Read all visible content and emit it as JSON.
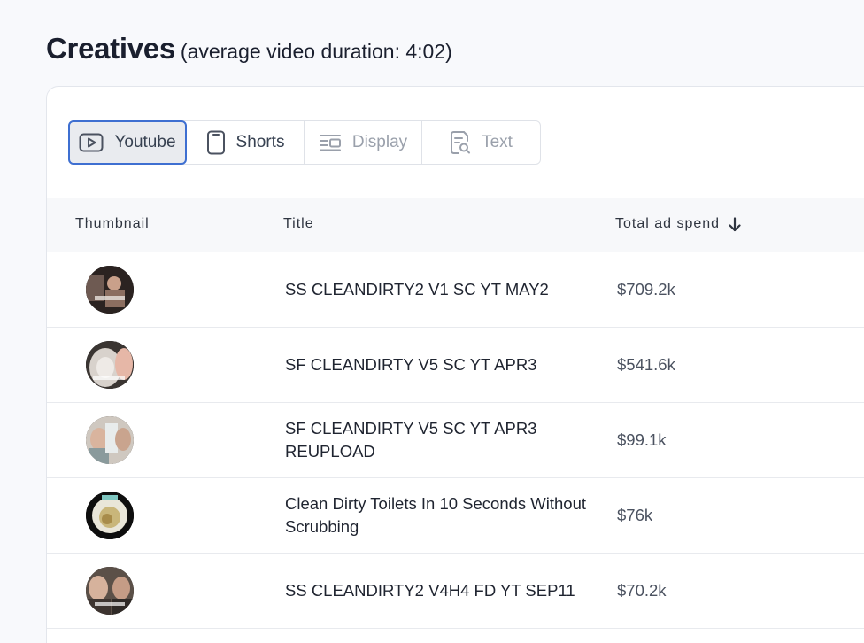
{
  "header": {
    "title": "Creatives",
    "subtitle": "(average video duration: 4:02)"
  },
  "tabs": [
    {
      "label": "Youtube",
      "icon": "play-icon",
      "state": "active"
    },
    {
      "label": "Shorts",
      "icon": "phone-icon",
      "state": "enabled"
    },
    {
      "label": "Display",
      "icon": "display-icon",
      "state": "disabled"
    },
    {
      "label": "Text",
      "icon": "text-search-icon",
      "state": "disabled"
    }
  ],
  "table": {
    "columns": [
      "Thumbnail",
      "Title",
      "Total ad spend"
    ],
    "sort_icon": "arrow-down-icon",
    "rows": [
      {
        "title": "SS CLEANDIRTY2 V1 SC YT MAY2",
        "spend": "$709.2k"
      },
      {
        "title": "SF CLEANDIRTY V5 SC YT APR3",
        "spend": "$541.6k"
      },
      {
        "title": "SF CLEANDIRTY V5 SC YT APR3 REUPLOAD",
        "spend": "$99.1k"
      },
      {
        "title": "Clean Dirty Toilets In 10 Seconds Without Scrubbing",
        "spend": "$76k"
      },
      {
        "title": "SS CLEANDIRTY2 V4H4 FD YT SEP11",
        "spend": "$70.2k"
      }
    ]
  },
  "colors": {
    "accent": "#3e6fd1",
    "page_bg": "#f8f9fc"
  }
}
